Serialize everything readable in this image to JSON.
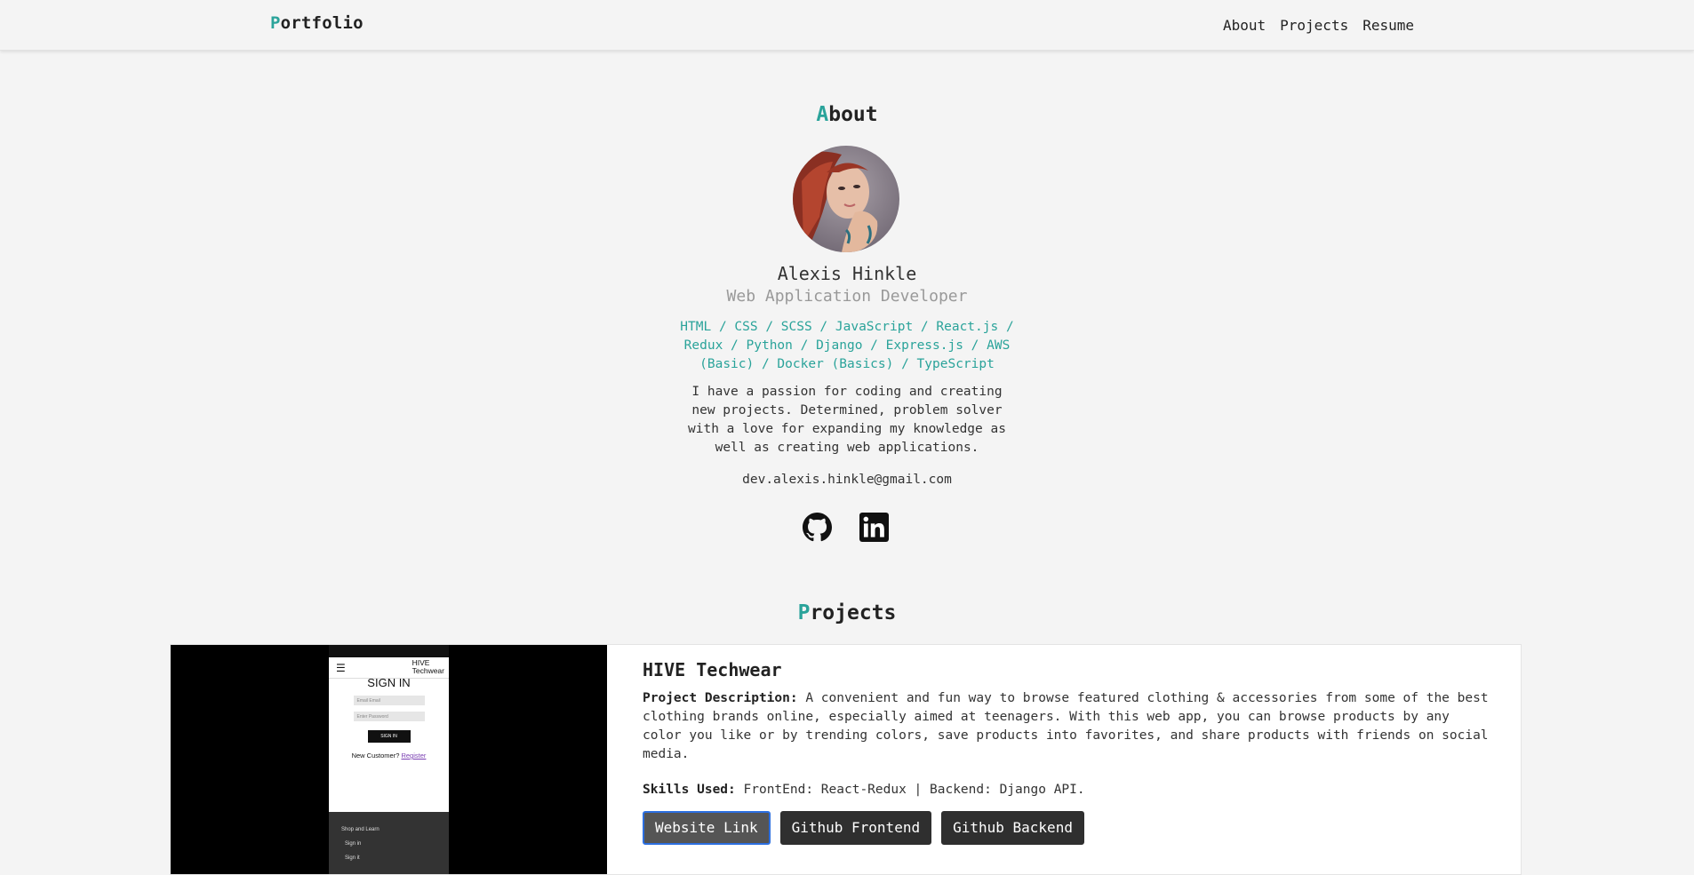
{
  "nav": {
    "brand_first": "P",
    "brand_rest": "ortfolio",
    "links": [
      "About",
      "Projects",
      "Resume"
    ]
  },
  "about": {
    "title_first": "A",
    "title_rest": "bout",
    "name": "Alexis Hinkle",
    "role": "Web Application Developer",
    "skills": "HTML / CSS / SCSS / JavaScript / React.js / Redux / Python / Django / Express.js / AWS (Basic) / Docker (Basics) / TypeScript",
    "bio": "I have a passion for coding and creating new projects. Determined, problem solver with a love for expanding my knowledge as well as creating web applications.",
    "email": "dev.alexis.hinkle@gmail.com",
    "socials": [
      {
        "name": "github",
        "icon": "github-icon"
      },
      {
        "name": "linkedin",
        "icon": "linkedin-icon"
      }
    ]
  },
  "projects": {
    "title_first": "P",
    "title_rest": "rojects",
    "items": [
      {
        "name": "HIVE Techwear",
        "description_label": "Project Description:",
        "description": "A convenient and fun way to browse featured clothing & accessories from some of the best clothing brands online, especially aimed at teenagers. With this web app, you can browse products by any color you like or by trending colors, save products into favorites, and share products with friends on social media.",
        "skills_label": "Skills Used:",
        "skills": "FrontEnd: React-Redux | Backend: Django API.",
        "buttons": [
          "Website Link",
          "Github Frontend",
          "Github Backend"
        ],
        "screenshot": {
          "header_logo_line1": "HIVE",
          "header_logo_line2": "Techwear",
          "signin": "SIGN IN",
          "email_placeholder": "Email Email",
          "password_placeholder": "Enter Password",
          "signin_button": "SIGN IN",
          "new_customer": "New Customer?",
          "register": "Register",
          "footer_title": "Shop and Learn",
          "footer_item1": "Sign in",
          "footer_item2": "Sign it"
        }
      }
    ]
  },
  "colors": {
    "accent": "#2aa39a",
    "background": "#f4f4f4",
    "button": "#2f2f2f",
    "focus_ring": "#2c6fe0"
  }
}
